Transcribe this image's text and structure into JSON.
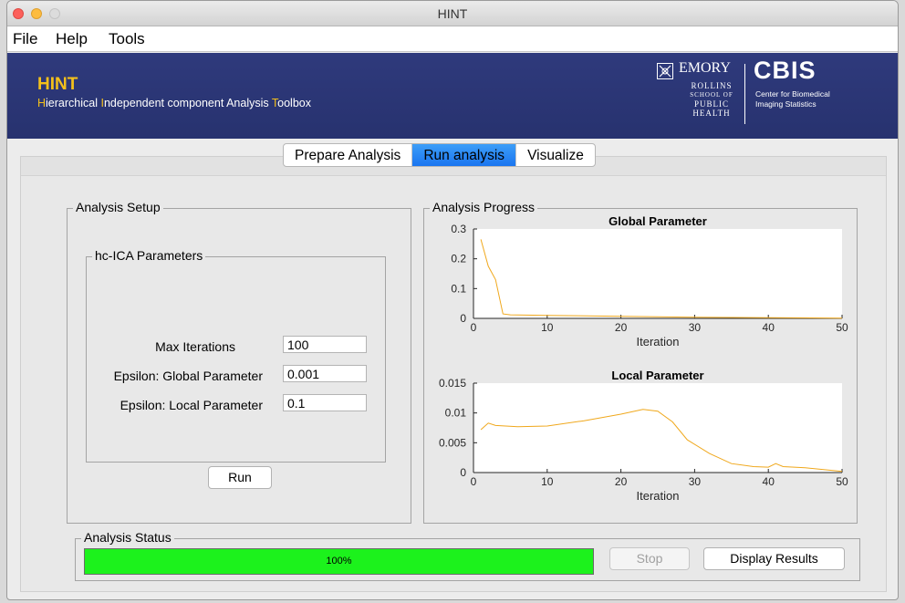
{
  "window": {
    "title": "HINT"
  },
  "menu": {
    "items": [
      "File",
      "Help",
      "Tools"
    ]
  },
  "banner": {
    "title": "HINT",
    "subtitle_parts": [
      {
        "text": "H",
        "accent": true
      },
      {
        "text": "ierarchical ",
        "accent": false
      },
      {
        "text": "I",
        "accent": true
      },
      {
        "text": "ndependent component Analysis ",
        "accent": false
      },
      {
        "text": "T",
        "accent": true
      },
      {
        "text": "oolbox",
        "accent": false
      }
    ],
    "emory_logo": {
      "name": "EMORY",
      "school_lines": [
        "ROLLINS",
        "SCHOOL OF",
        "PUBLIC",
        "HEALTH"
      ]
    },
    "cbis_logo": {
      "name": "CBIS",
      "sub_lines": [
        "Center for Biomedical",
        "Imaging Statistics"
      ]
    }
  },
  "tabs": [
    {
      "label": "Prepare Analysis",
      "active": false
    },
    {
      "label": "Run analysis",
      "active": true
    },
    {
      "label": "Visualize",
      "active": false
    }
  ],
  "setup": {
    "group_label": "Analysis Setup",
    "params_label": "hc-ICA Parameters",
    "params": [
      {
        "label": "Max Iterations",
        "value": "100"
      },
      {
        "label": "Epsilon: Global Parameter",
        "value": "0.001"
      },
      {
        "label": "Epsilon: Local Parameter",
        "value": "0.1"
      }
    ],
    "run_label": "Run"
  },
  "progress_panel": {
    "group_label": "Analysis Progress"
  },
  "status": {
    "group_label": "Analysis Status",
    "progress_text": "100%",
    "progress_value": 1.0,
    "stop_label": "Stop",
    "display_label": "Display Results"
  },
  "colors": {
    "banner": "#2a3676",
    "accent": "#f3c01b",
    "line": "#f0a81c",
    "progress": "#1cf21c",
    "active_tab": "#2a87f5"
  },
  "chart_data": [
    {
      "type": "line",
      "title": "Global Parameter",
      "xlabel": "Iteration",
      "ylabel": "",
      "xlim": [
        0,
        50
      ],
      "ylim": [
        0,
        0.3
      ],
      "xticks": [
        0,
        10,
        20,
        30,
        40,
        50
      ],
      "yticks": [
        0,
        0.1,
        0.2,
        0.3
      ],
      "ytick_labels": [
        "0",
        "0.1",
        "0.2",
        "0.3"
      ],
      "series": [
        {
          "color": "#f0a81c",
          "points": [
            [
              1,
              0.265
            ],
            [
              2,
              0.175
            ],
            [
              3,
              0.13
            ],
            [
              4,
              0.015
            ],
            [
              5,
              0.012
            ],
            [
              10,
              0.01
            ],
            [
              20,
              0.007
            ],
            [
              30,
              0.004
            ],
            [
              40,
              0.002
            ],
            [
              50,
              0.001
            ]
          ]
        }
      ]
    },
    {
      "type": "line",
      "title": "Local Parameter",
      "xlabel": "Iteration",
      "ylabel": "",
      "xlim": [
        0,
        50
      ],
      "ylim": [
        0,
        0.015
      ],
      "xticks": [
        0,
        10,
        20,
        30,
        40,
        50
      ],
      "yticks": [
        0,
        0.005,
        0.01,
        0.015
      ],
      "ytick_labels": [
        "0",
        "0.005",
        "0.01",
        "0.015"
      ],
      "series": [
        {
          "color": "#f0a81c",
          "points": [
            [
              1,
              0.0072
            ],
            [
              2,
              0.0083
            ],
            [
              3,
              0.0079
            ],
            [
              6,
              0.0077
            ],
            [
              10,
              0.0078
            ],
            [
              15,
              0.0087
            ],
            [
              20,
              0.0098
            ],
            [
              23,
              0.0106
            ],
            [
              25,
              0.0103
            ],
            [
              27,
              0.0085
            ],
            [
              29,
              0.0055
            ],
            [
              32,
              0.0032
            ],
            [
              35,
              0.0015
            ],
            [
              38,
              0.001
            ],
            [
              40,
              0.0009
            ],
            [
              41,
              0.0015
            ],
            [
              42,
              0.001
            ],
            [
              45,
              0.0008
            ],
            [
              50,
              0.0002
            ]
          ]
        }
      ]
    }
  ]
}
